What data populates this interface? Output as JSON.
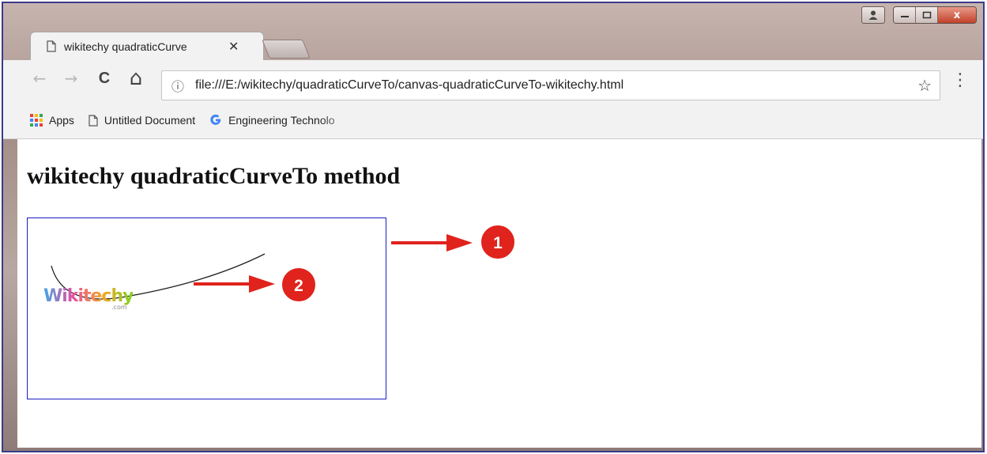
{
  "browser": {
    "tab": {
      "title": "wikitechy quadraticCurve",
      "close_glyph": "✕"
    },
    "nav": {
      "back": "←",
      "forward": "→",
      "reload": "C",
      "home": "⌂"
    },
    "address_bar": {
      "url": "file:///E:/wikitechy/quadraticCurveTo/canvas-quadraticCurveTo-wikitechy.html",
      "info_glyph": "ⓘ",
      "star_glyph": "☆"
    },
    "menu_glyph": "⋮",
    "bookmarks": [
      {
        "label": "Apps",
        "icon": "apps-grid-icon"
      },
      {
        "label": "Untitled Document",
        "icon": "document-icon"
      },
      {
        "label": "Engineering Technolo",
        "icon": "google-g-icon"
      }
    ],
    "window_controls": {
      "close": "x"
    }
  },
  "page": {
    "heading": "wikitechy quadraticCurveTo method",
    "canvas": {
      "border_color": "#1c1cc4",
      "logo_text": "Wikitechy",
      "logo_suffix": ".com"
    },
    "callouts": [
      {
        "number": "1",
        "color": "#e0231c"
      },
      {
        "number": "2",
        "color": "#e0231c"
      }
    ]
  },
  "colors": {
    "window_border": "#3a3a8c",
    "callout_red": "#e0231c"
  }
}
